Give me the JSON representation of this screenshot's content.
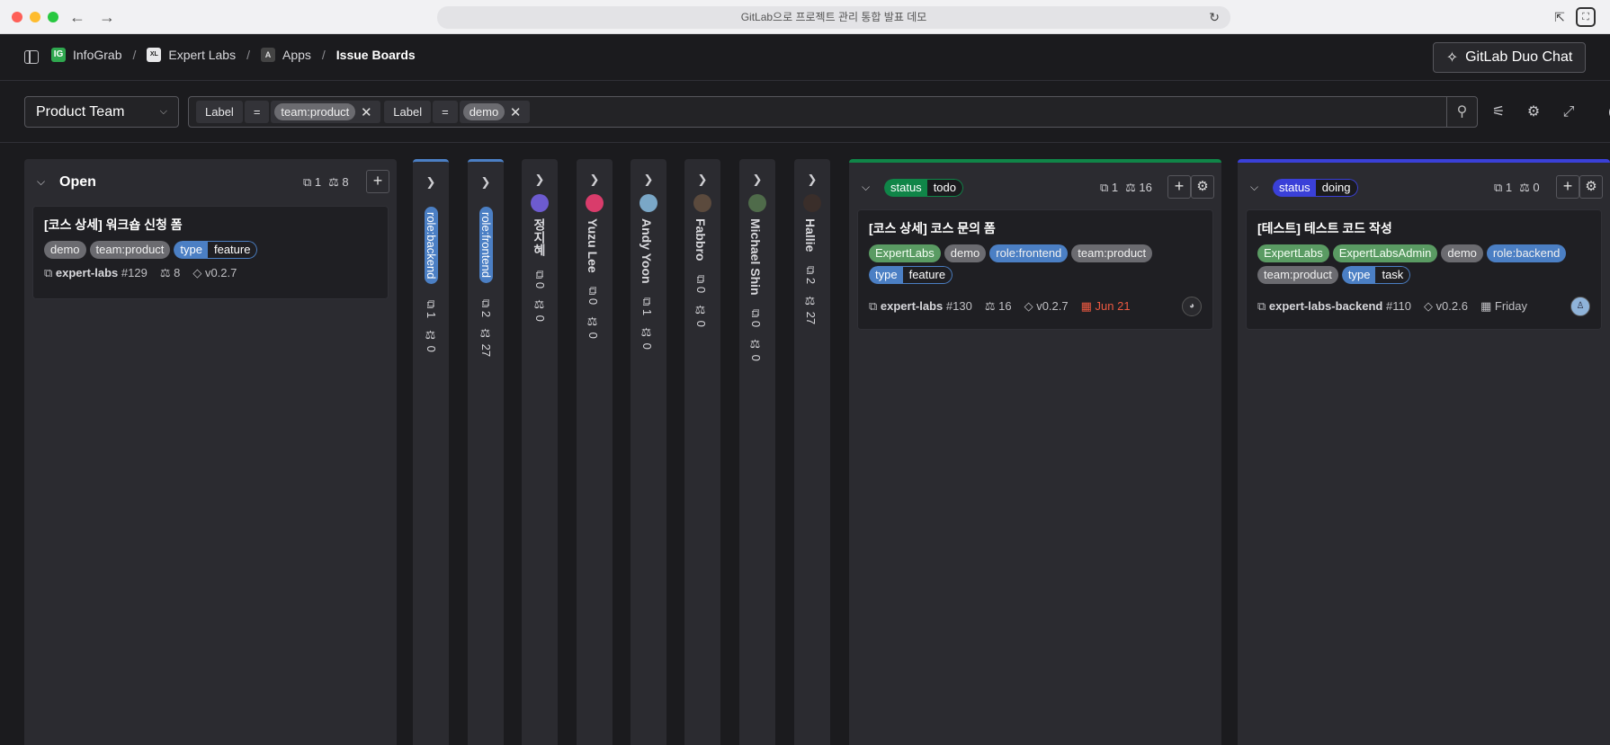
{
  "browser": {
    "url_title": "GitLab으로 프로젝트 관리 통합 발표 데모",
    "back_icon": "←",
    "forward_icon": "→",
    "reload_icon": "↻",
    "share_icon": "⇱",
    "expand_icon": "⛶"
  },
  "breadcrumb": {
    "items": [
      {
        "logo": "IG",
        "label": "InfoGrab"
      },
      {
        "logo": "XL",
        "label": "Expert Labs"
      },
      {
        "logo": "A",
        "label": "Apps"
      }
    ],
    "current": "Issue Boards"
  },
  "duo_button": "GitLab Duo Chat",
  "board_select": "Product Team",
  "filters": [
    {
      "field": "Label",
      "op": "=",
      "value": "team:product"
    },
    {
      "field": "Label",
      "op": "=",
      "value": "demo"
    }
  ],
  "lists": {
    "open": {
      "title": "Open",
      "issues": "1",
      "weight": "8",
      "cards": [
        {
          "title": "[코스 상세] 워크숍 신청 폼",
          "labels": [
            "demo",
            "team:product"
          ],
          "scoped": {
            "k": "type",
            "v": "feature"
          },
          "ref": "expert-labs",
          "num": "#129",
          "weight": "8",
          "milestone": "v0.2.7"
        }
      ]
    },
    "collapsed": [
      {
        "name": "role:backend",
        "kind": "label",
        "issues": "1",
        "weight": "0"
      },
      {
        "name": "role:frontend",
        "kind": "label",
        "issues": "2",
        "weight": "27"
      },
      {
        "name": "정지혜",
        "kind": "user",
        "issues": "0",
        "weight": "0"
      },
      {
        "name": "Yuzu Lee",
        "kind": "user",
        "issues": "0",
        "weight": "0"
      },
      {
        "name": "Andy Yoon",
        "kind": "user",
        "issues": "1",
        "weight": "0"
      },
      {
        "name": "Fabbro",
        "kind": "user",
        "issues": "0",
        "weight": "0"
      },
      {
        "name": "Michael Shin",
        "kind": "user",
        "issues": "0",
        "weight": "0"
      },
      {
        "name": "Hallie",
        "kind": "user",
        "issues": "2",
        "weight": "27"
      }
    ],
    "todo": {
      "scope_k": "status",
      "scope_v": "todo",
      "issues": "1",
      "weight": "16",
      "cards": [
        {
          "title": "[코스 상세] 코스 문의 폼",
          "labels": [
            "ExpertLabs",
            "demo",
            "role:frontend",
            "team:product"
          ],
          "scoped": {
            "k": "type",
            "v": "feature"
          },
          "ref": "expert-labs",
          "num": "#130",
          "weight": "16",
          "milestone": "v0.2.7",
          "due": "Jun 21"
        }
      ]
    },
    "doing": {
      "scope_k": "status",
      "scope_v": "doing",
      "issues": "1",
      "weight": "0",
      "cards": [
        {
          "title": "[테스트] 테스트 코드 작성",
          "labels": [
            "ExpertLabs",
            "ExpertLabsAdmin",
            "demo",
            "role:backend",
            "team:product"
          ],
          "scoped": {
            "k": "type",
            "v": "task"
          },
          "ref": "expert-labs-backend",
          "num": "#110",
          "milestone": "v0.2.6",
          "due": "Friday"
        }
      ]
    }
  },
  "colors": {
    "todo_accent": "#108548",
    "doing_accent": "#3a40d8",
    "label_blue": "#4b7fc4",
    "due_overdue": "#ec5941"
  }
}
